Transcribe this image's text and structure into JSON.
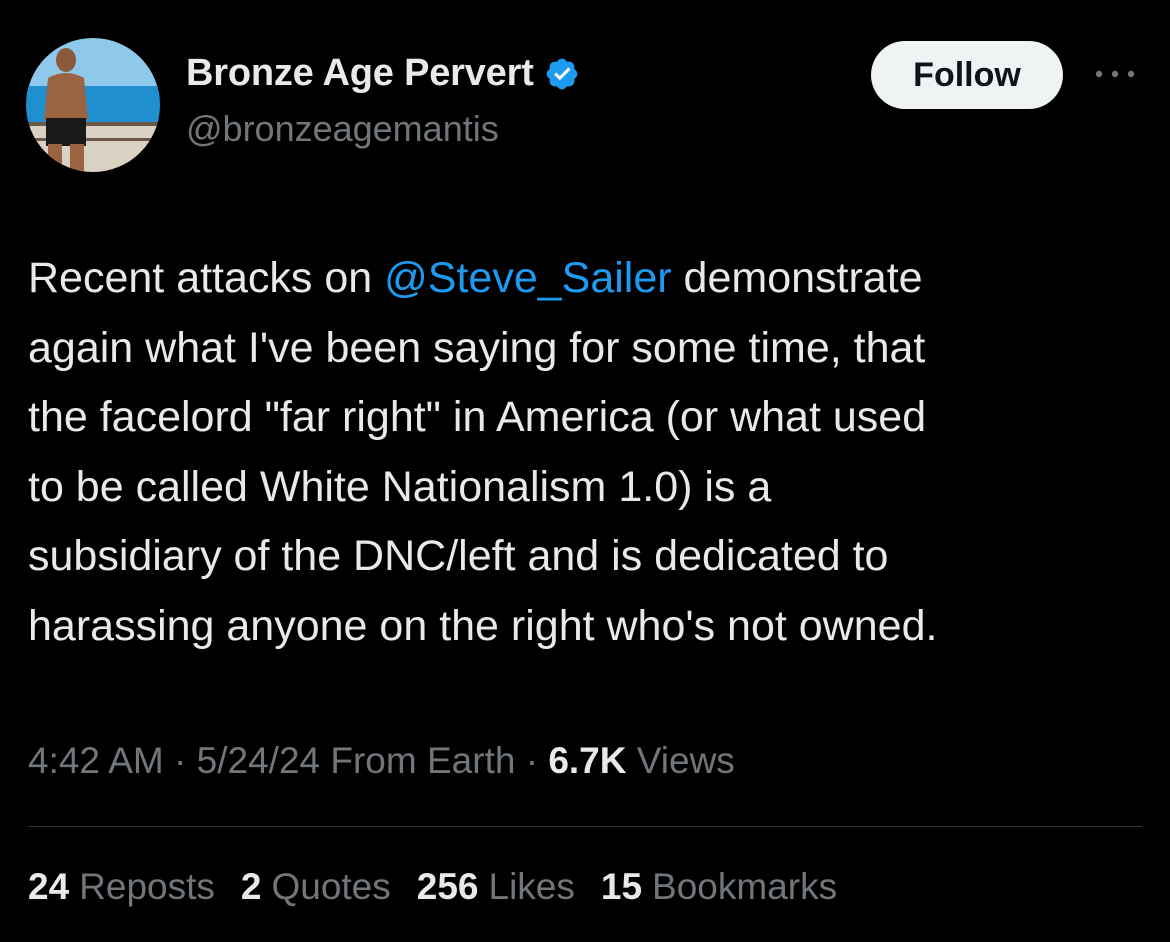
{
  "author": {
    "display_name": "Bronze Age Pervert",
    "handle": "@bronzeagemantis",
    "verified_icon": "verified-badge-icon",
    "verified_color": "#1d9bf0"
  },
  "actions": {
    "follow_label": "Follow",
    "more_icon": "more-horizontal-icon"
  },
  "tweet": {
    "segments": [
      {
        "text": "Recent attacks on "
      },
      {
        "text": "@Steve_Sailer"
      },
      {
        "text": " demonstrate"
      },
      {
        "text": "again what I've been saying for some time, that"
      },
      {
        "text": "the facelord \"far right\" in America (or what used"
      },
      {
        "text": "to be called White Nationalism 1.0) is a"
      },
      {
        "text": "subsidiary of the DNC/left and is dedicated to"
      },
      {
        "text": "harassing anyone on the right who's not owned."
      }
    ]
  },
  "meta": {
    "time": "4:42 AM",
    "sep1": " · ",
    "date": "5/24/24",
    "source": " From Earth",
    "sep2": " · ",
    "views_count": "6.7K",
    "views_label": " Views"
  },
  "stats": [
    {
      "num": "24",
      "label": "Reposts"
    },
    {
      "num": "2",
      "label": "Quotes"
    },
    {
      "num": "256",
      "label": "Likes"
    },
    {
      "num": "15",
      "label": "Bookmarks"
    }
  ],
  "colors": {
    "background": "#000000",
    "primary_text": "#e7e9ea",
    "secondary_text": "#71767b",
    "link": "#1d9bf0",
    "divider": "#2f3336"
  }
}
